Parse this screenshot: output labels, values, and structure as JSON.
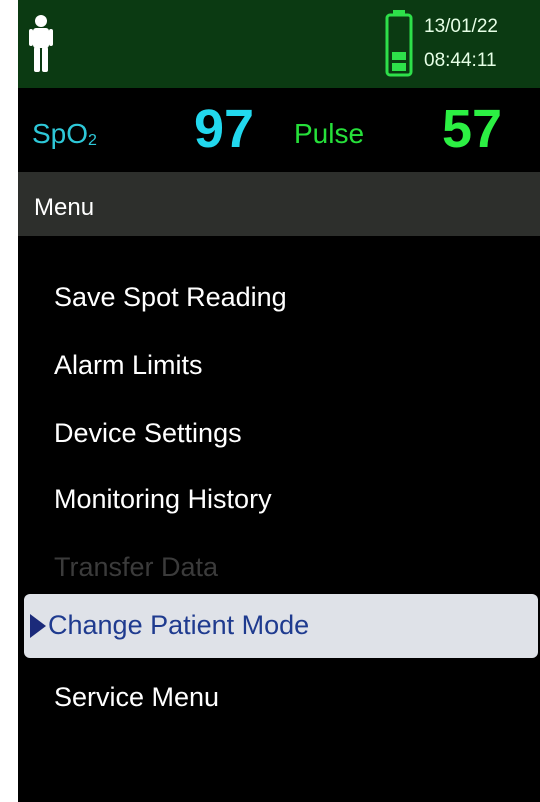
{
  "status": {
    "date": "13/01/22",
    "time": "08:44:11",
    "person_icon": "person-icon",
    "battery_icon": "battery-icon"
  },
  "readings": {
    "spo2_label": "SpO",
    "spo2_label_sub": "2",
    "spo2_value": "97",
    "pulse_label": "Pulse",
    "pulse_value": "57"
  },
  "menu": {
    "title": "Menu",
    "items": [
      {
        "label": "Save Spot Reading",
        "enabled": true
      },
      {
        "label": "Alarm Limits",
        "enabled": true
      },
      {
        "label": "Device Settings",
        "enabled": true
      },
      {
        "label": "Monitoring History",
        "enabled": true
      },
      {
        "label": "Transfer Data",
        "enabled": false
      },
      {
        "label": "Change Patient Mode",
        "enabled": true,
        "selected": true
      },
      {
        "label": "Service Menu",
        "enabled": true
      }
    ]
  },
  "colors": {
    "status_bar": "#0b3a12",
    "spo2": "#22d8ee",
    "pulse": "#2cf043",
    "selection": "#dfe2e8"
  }
}
